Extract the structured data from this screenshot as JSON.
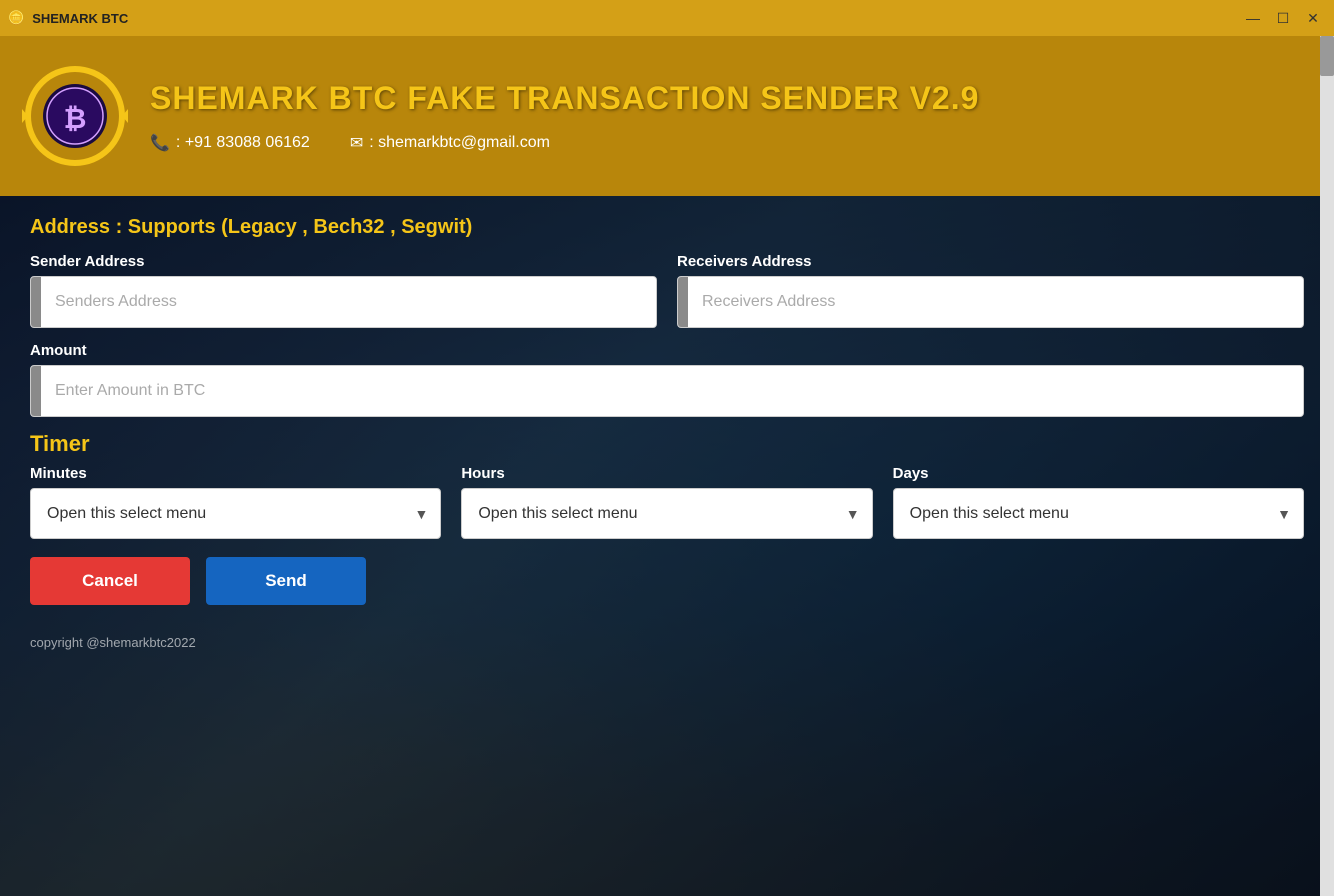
{
  "titleBar": {
    "icon": "🪙",
    "title": "SHEMARK BTC",
    "minimizeLabel": "—",
    "maximizeLabel": "☐",
    "closeLabel": "✕"
  },
  "header": {
    "appTitle": "SHEMARK BTC FAKE TRANSACTION SENDER V2.9",
    "phone": ": +91 83088 06162",
    "email": ": shemarkbtc@gmail.com"
  },
  "form": {
    "addressSupports": "Address : Supports (Legacy , Bech32 , Segwit)",
    "senderAddressLabel": "Sender Address",
    "senderAddressPlaceholder": "Senders Address",
    "receiverAddressLabel": "Receivers Address",
    "receiverAddressPlaceholder": "Receivers Address",
    "amountLabel": "Amount",
    "amountPlaceholder": "Enter Amount in BTC"
  },
  "timer": {
    "title": "Timer",
    "minutesLabel": "Minutes",
    "hoursLabel": "Hours",
    "daysLabel": "Days",
    "selectPlaceholder": "Open this select menu"
  },
  "buttons": {
    "cancelLabel": "Cancel",
    "sendLabel": "Send"
  },
  "footer": {
    "copyright": "copyright @shemarkbtc2022"
  }
}
